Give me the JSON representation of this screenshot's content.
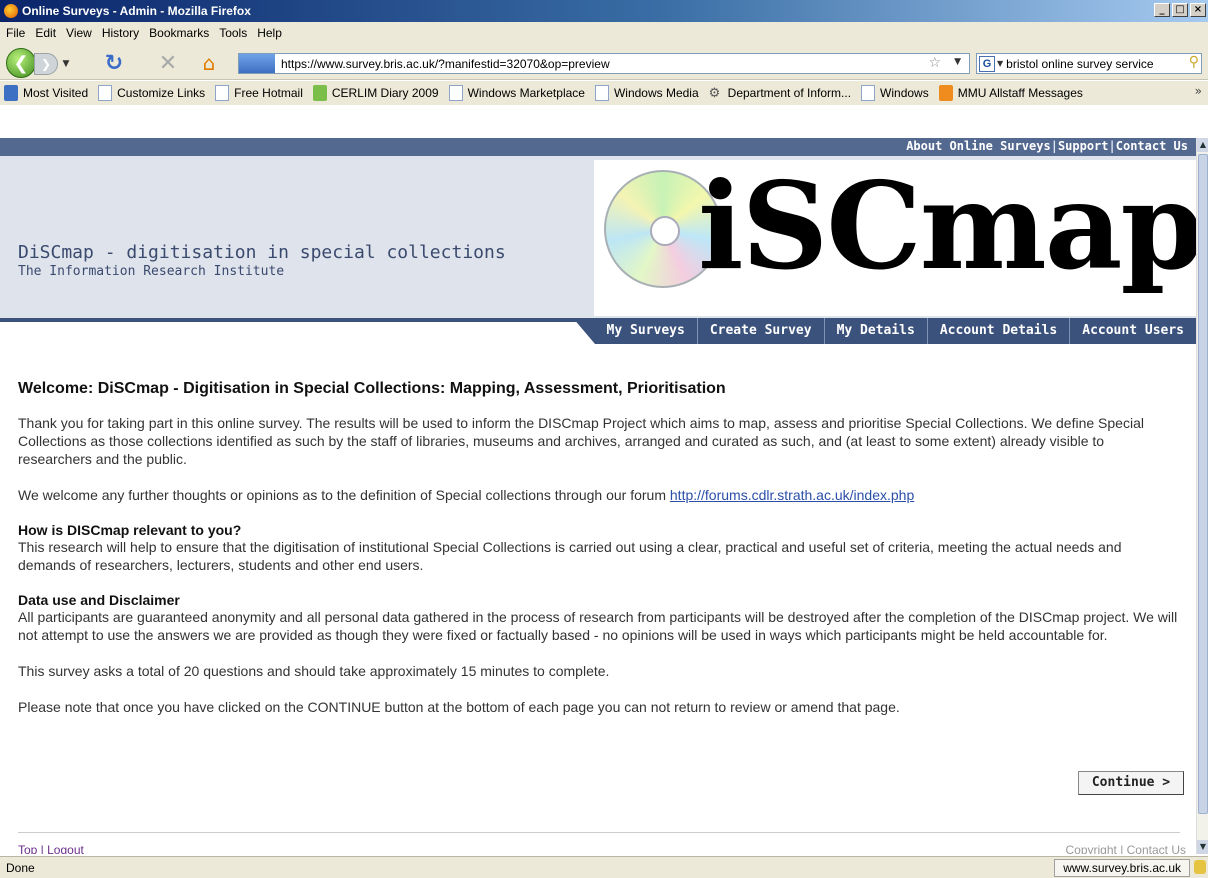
{
  "window": {
    "title": "Online Surveys - Admin - Mozilla Firefox",
    "buttons": [
      "_",
      "□",
      "×"
    ]
  },
  "menu": [
    "File",
    "Edit",
    "View",
    "History",
    "Bookmarks",
    "Tools",
    "Help"
  ],
  "nav": {
    "url": "https://www.survey.bris.ac.uk/?manifestid=32070&op=preview",
    "search_value": "bristol online survey service"
  },
  "bookmarks": [
    {
      "label": "Most Visited",
      "icon": "most-visited-icon"
    },
    {
      "label": "Customize Links",
      "icon": "page-icon"
    },
    {
      "label": "Free Hotmail",
      "icon": "page-icon"
    },
    {
      "label": "CERLIM Diary 2009",
      "icon": "calendar-icon"
    },
    {
      "label": "Windows Marketplace",
      "icon": "page-icon"
    },
    {
      "label": "Windows Media",
      "icon": "page-icon"
    },
    {
      "label": "Department of Inform...",
      "icon": "gear-icon"
    },
    {
      "label": "Windows",
      "icon": "page-icon"
    },
    {
      "label": "MMU Allstaff Messages",
      "icon": "rss-icon"
    }
  ],
  "site": {
    "top_links": [
      "About Online Surveys",
      "Support",
      "Contact Us"
    ],
    "name": "DiSCmap - digitisation in special collections",
    "subtitle": "The Information Research Institute",
    "logo_text": "iSCmap",
    "tabs": [
      "My Surveys",
      "Create Survey",
      "My Details",
      "Account Details",
      "Account Users"
    ]
  },
  "content": {
    "title": "Welcome: DiSCmap - Digitisation in Special Collections: Mapping, Assessment, Prioritisation",
    "intro": "Thank you for taking part in this online survey. The results will be used to inform the DISCmap Project which aims to map, assess and prioritise Special Collections. We define Special Collections as those collections identified as such by the staff of libraries, museums and archives, arranged and curated as such, and (at least to some extent) already visible to researchers and the public.",
    "forum_text": "We welcome any further thoughts or opinions as to the definition of Special collections through our forum ",
    "forum_link": "http://forums.cdlr.strath.ac.uk/index.php",
    "relevance_heading": "How is DISCmap relevant to you?",
    "relevance_text": "This research will help to ensure that the digitisation of institutional Special Collections is carried out using a clear, practical and useful set of criteria, meeting the actual needs and demands of researchers, lecturers, students and other end users.",
    "disclaimer_heading": "Data use and Disclaimer",
    "disclaimer_text": "All participants are guaranteed anonymity and all personal data gathered in the process of research from participants will be destroyed after the completion of the DISCmap project. We will not attempt to use the answers we are provided as though they were fixed or factually based - no opinions will be used in ways which participants might be held accountable for.",
    "length_text": "This survey asks a total of 20 questions and should take approximately 15 minutes to complete.",
    "note_text": "Please note that once you have clicked on the CONTINUE button at the bottom of each page you can not return to review or amend that page.",
    "continue_label": "Continue >"
  },
  "footer": {
    "left": "Top | Logout",
    "right": "Copyright | Contact Us"
  },
  "status": {
    "left": "Done",
    "right": "www.survey.bris.ac.uk"
  }
}
